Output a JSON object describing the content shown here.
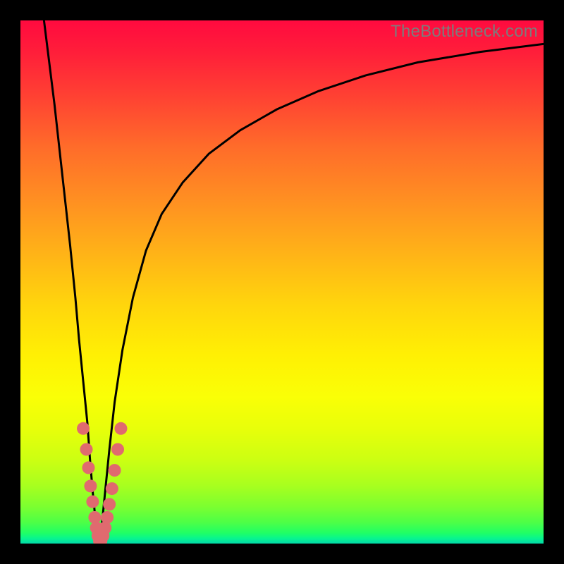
{
  "watermark": "TheBottleneck.com",
  "colors": {
    "frame": "#000000",
    "curve": "#000000",
    "scatter": "#e06a6f",
    "gradient_stops": [
      "#ff0a3f",
      "#ff1e3a",
      "#ff3f33",
      "#ff6b2a",
      "#ff8e22",
      "#ffb118",
      "#ffd40d",
      "#fff004",
      "#faff06",
      "#e8ff0a",
      "#ccff12",
      "#a7ff1f",
      "#7bff30",
      "#4cff47",
      "#1fff66",
      "#08f58e",
      "#03d8a8"
    ]
  },
  "chart_data": {
    "type": "line",
    "title": "",
    "xlabel": "",
    "ylabel": "",
    "xlim": [
      0,
      100
    ],
    "ylim": [
      0,
      100
    ],
    "series": [
      {
        "name": "left-branch",
        "x": [
          4.5,
          5.5,
          6.5,
          7.5,
          8.5,
          9.5,
          10.5,
          11.2,
          12.0,
          12.8,
          13.3,
          13.8,
          14.2,
          14.6,
          15.0,
          15.2
        ],
        "values": [
          100,
          92,
          84,
          75,
          66,
          57,
          47,
          39,
          31,
          23,
          16,
          10,
          6,
          3,
          1,
          0
        ]
      },
      {
        "name": "right-branch",
        "x": [
          15.2,
          15.6,
          16.2,
          17.0,
          18.0,
          19.5,
          21.5,
          24.0,
          27.0,
          31.0,
          36.0,
          42.0,
          49.0,
          57.0,
          66.0,
          76.0,
          88.0,
          100.0
        ],
        "values": [
          0,
          4,
          10,
          18,
          27,
          37,
          47,
          56,
          63,
          69,
          74.5,
          79,
          83,
          86.5,
          89.5,
          92,
          94,
          95.5
        ]
      }
    ],
    "scatter": {
      "name": "sample-points",
      "points": [
        {
          "x": 12.0,
          "y": 22.0
        },
        {
          "x": 12.6,
          "y": 18.0
        },
        {
          "x": 13.0,
          "y": 14.5
        },
        {
          "x": 13.4,
          "y": 11.0
        },
        {
          "x": 13.8,
          "y": 8.0
        },
        {
          "x": 14.2,
          "y": 5.0
        },
        {
          "x": 14.5,
          "y": 3.0
        },
        {
          "x": 14.8,
          "y": 1.5
        },
        {
          "x": 15.1,
          "y": 0.5
        },
        {
          "x": 15.4,
          "y": 0.5
        },
        {
          "x": 15.8,
          "y": 1.5
        },
        {
          "x": 16.2,
          "y": 3.0
        },
        {
          "x": 16.6,
          "y": 5.0
        },
        {
          "x": 17.0,
          "y": 7.5
        },
        {
          "x": 17.5,
          "y": 10.5
        },
        {
          "x": 18.0,
          "y": 14.0
        },
        {
          "x": 18.6,
          "y": 18.0
        },
        {
          "x": 19.2,
          "y": 22.0
        }
      ]
    }
  }
}
